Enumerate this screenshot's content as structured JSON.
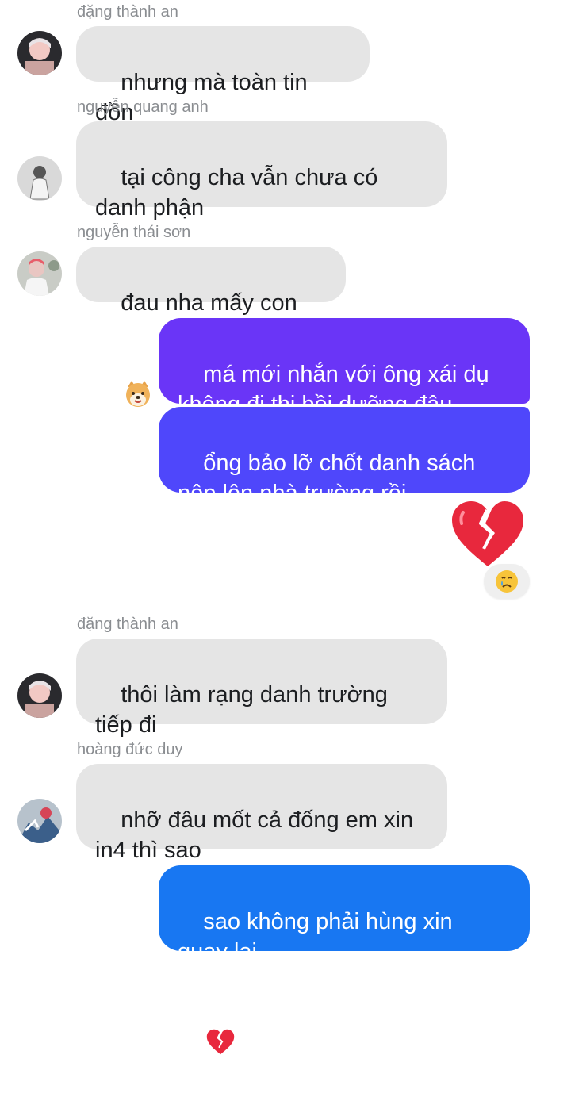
{
  "colors": {
    "incoming_bubble": "#e5e5e5",
    "outgoing_purple": "#6a35f7",
    "outgoing_indigo": "#4f47fb",
    "outgoing_blue": "#1877f2",
    "sender_name": "#8a8d91"
  },
  "messages": [
    {
      "sender": "đặng thành an",
      "text": "nhưng mà toàn tin đồn",
      "avatar": "avatar-dang-thanh-an"
    },
    {
      "sender": "nguyễn quang anh",
      "text": "tại công cha vẫn chưa có\ndanh phận",
      "avatar": "avatar-nguyen-quang-anh"
    },
    {
      "sender": "nguyễn thái sơn",
      "text": "đau nha mấy con",
      "emoji": "dog-face-emoji",
      "avatar": "avatar-nguyen-thai-son"
    },
    {
      "outgoing": true,
      "text": "má mới nhắn với ông xái dụ\nkhông đi thi bồi dưỡng đâu"
    },
    {
      "outgoing": true,
      "text": "ổng bảo lỡ chốt danh sách\nnộp lên nhà trường rồi"
    },
    {
      "outgoing": true,
      "emoji": "broken-heart-emoji",
      "reaction": "crying-face-emoji"
    },
    {
      "sender": "đặng thành an",
      "text": "thôi làm rạng danh trường\ntiếp đi",
      "avatar": "avatar-dang-thanh-an"
    },
    {
      "sender": "hoàng đức duy",
      "text": "nhỡ đâu mốt cả đống em xin\nin4 thì sao",
      "avatar": "avatar-hoang-duc-duy"
    },
    {
      "outgoing": true,
      "text": "sao không phải hùng xin\nquay lại",
      "emoji": "broken-heart-emoji"
    }
  ]
}
